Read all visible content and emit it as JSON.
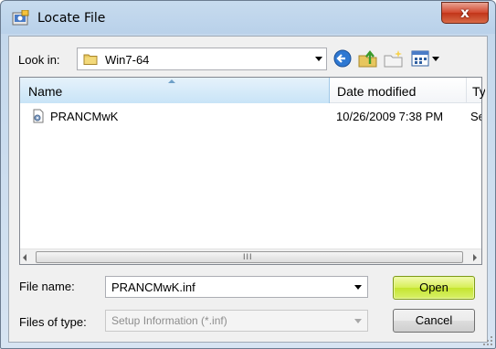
{
  "window": {
    "title": "Locate File",
    "close_label": "x"
  },
  "lookin": {
    "label": "Look in:",
    "value": "Win7-64"
  },
  "toolbar": {
    "icons": [
      "back-icon",
      "up-folder-icon",
      "new-folder-icon",
      "views-menu-icon"
    ]
  },
  "filelist": {
    "columns": [
      "Name",
      "Date modified",
      "Ty"
    ],
    "rows": [
      {
        "name": "PRANCMwK",
        "date": "10/26/2009 7:38 PM",
        "type": "Se"
      }
    ],
    "scroll_grip": "III"
  },
  "filename": {
    "label": "File name:",
    "value": "PRANCMwK.inf"
  },
  "filetype": {
    "label": "Files of type:",
    "value": "Setup Information (*.inf)"
  },
  "buttons": {
    "open": "Open",
    "cancel": "Cancel"
  },
  "colors": {
    "open_button": "#d6ef56",
    "close_button": "#d2472d",
    "header_highlight": "#c8e4f7"
  }
}
